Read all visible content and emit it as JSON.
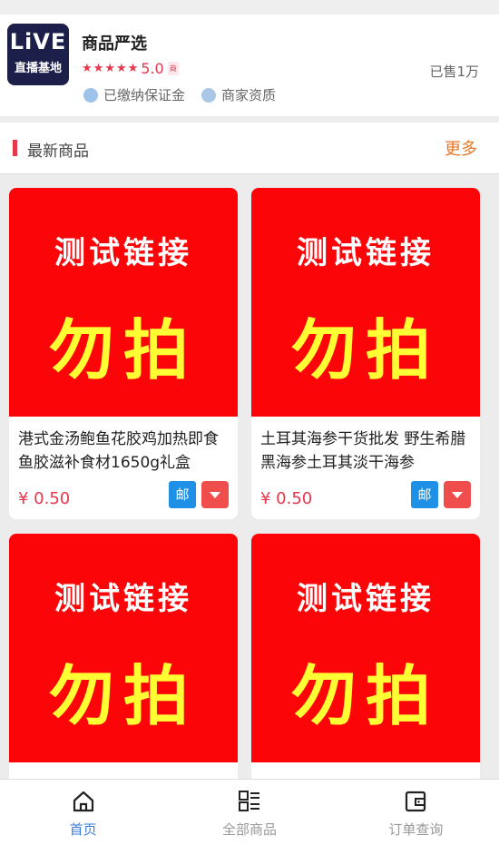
{
  "shop": {
    "logo_text_top": "LiVE",
    "logo_text_bottom": "直播基地",
    "name": "商品严选",
    "rating": "5.0",
    "rating_tag": "商",
    "sold": "已售1万",
    "badges": [
      "已缴纳保证金",
      "商家资质"
    ]
  },
  "section": {
    "title": "最新商品",
    "more": "更多"
  },
  "products": [
    {
      "img_line1": "测试链接",
      "img_line2": "勿拍",
      "title": "港式金汤鲍鱼花胶鸡加热即食鱼胶滋补食材1650g礼盒",
      "price": "¥ 0.50",
      "post": "邮"
    },
    {
      "img_line1": "测试链接",
      "img_line2": "勿拍",
      "title": "土耳其海参干货批发 野生希腊黑海参土耳其淡干海参",
      "price": "¥ 0.50",
      "post": "邮"
    },
    {
      "img_line1": "测试链接",
      "img_line2": "勿拍",
      "title": "",
      "price": "",
      "post": ""
    },
    {
      "img_line1": "测试链接",
      "img_line2": "勿拍",
      "title": "",
      "price": "",
      "post": ""
    }
  ],
  "tabs": [
    {
      "label": "首页",
      "icon": "home-icon",
      "active": true
    },
    {
      "label": "全部商品",
      "icon": "list-icon",
      "active": false
    },
    {
      "label": "订单查询",
      "icon": "wallet-icon",
      "active": false
    }
  ],
  "colors": {
    "accent": "#e8364b",
    "more": "#e97626",
    "tab_active": "#3a7bd5",
    "product_bg": "#fb0508"
  }
}
